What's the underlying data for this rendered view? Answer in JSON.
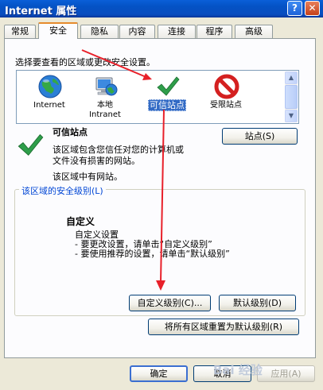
{
  "window": {
    "title": "Internet 属性"
  },
  "titlebar_buttons": {
    "help": "?",
    "close": "✕"
  },
  "tabs": [
    {
      "label": "常规"
    },
    {
      "label": "安全"
    },
    {
      "label": "隐私"
    },
    {
      "label": "内容"
    },
    {
      "label": "连接"
    },
    {
      "label": "程序"
    },
    {
      "label": "高级"
    }
  ],
  "security": {
    "select_zone_label": "选择要查看的区域或更改安全设置。",
    "zones": [
      {
        "name": "Internet",
        "icon": "globe-icon"
      },
      {
        "name": "本地\nIntranet",
        "icon": "local-intranet-icon"
      },
      {
        "name": "可信站点",
        "icon": "check-icon"
      },
      {
        "name": "受限站点",
        "icon": "restricted-icon"
      }
    ],
    "scroll": {
      "up": "▲",
      "down": "▼"
    },
    "zone_title": "可信站点",
    "zone_desc_line1": "该区域包含您信任对您的计算机或",
    "zone_desc_line2": "文件没有损害的网站。",
    "zone_sites_note": "该区域中有网站。",
    "sites_button": "站点(S)",
    "level_group_label": "该区域的安全级别(L)",
    "custom_title": "自定义",
    "custom_line1": "自定义设置",
    "custom_line2": "- 要更改设置，请单击“自定义级别”",
    "custom_line3": "- 要使用推荐的设置，请单击“默认级别”",
    "custom_level_button": "自定义级别(C)...",
    "default_level_button": "默认级别(D)",
    "reset_all_button": "将所有区域重置为默认级别(R)"
  },
  "footer": {
    "ok": "确定",
    "cancel": "取消",
    "apply": "应用(A)"
  },
  "watermark": "Bai 经验",
  "colors": {
    "title_bar": "#0a5fd8",
    "selection": "#316ac5",
    "arrow": "#e8202a",
    "check": "#2e9e4a",
    "restricted": "#d42020"
  }
}
